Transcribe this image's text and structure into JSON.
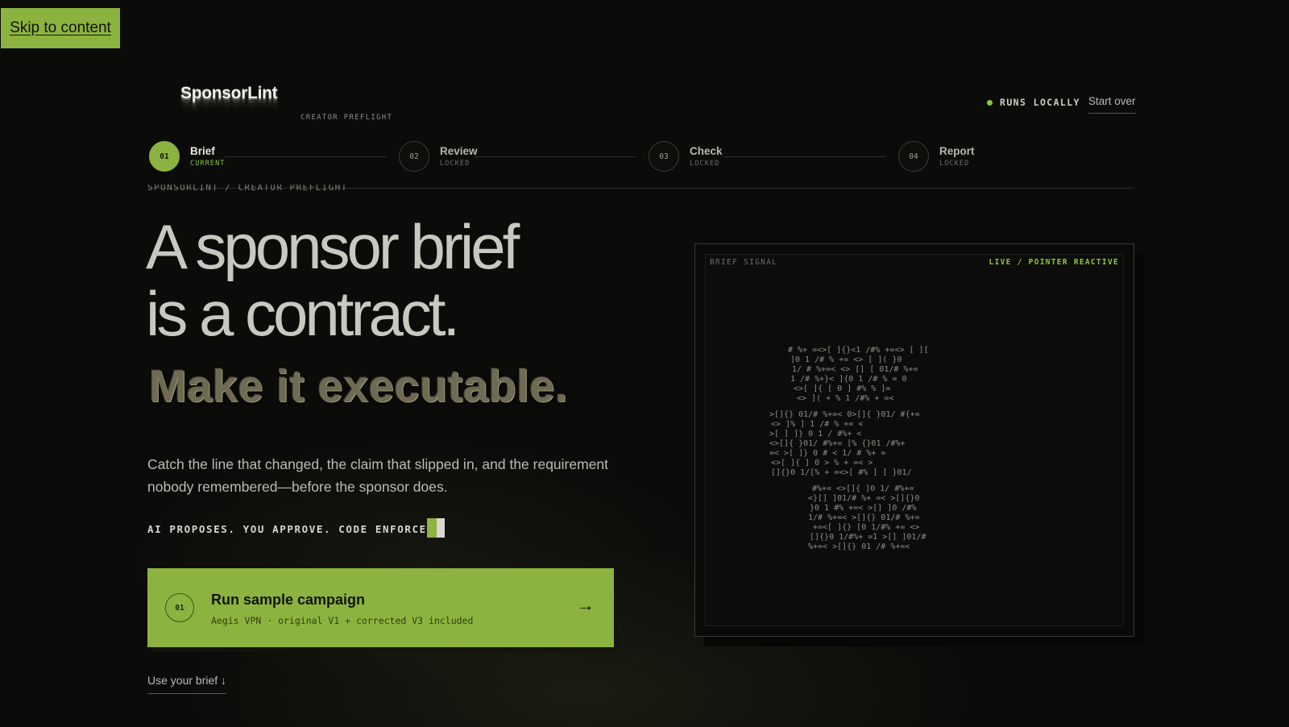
{
  "skip_link": "Skip to content",
  "header": {
    "brand": "SponsorLint",
    "brand_sub": "CREATOR PREFLIGHT",
    "status": "RUNS LOCALLY",
    "start_over": "Start over"
  },
  "steps": [
    {
      "num": "01",
      "title": "Brief",
      "state": "CURRENT"
    },
    {
      "num": "02",
      "title": "Review",
      "state": "LOCKED"
    },
    {
      "num": "03",
      "title": "Check",
      "state": "LOCKED"
    },
    {
      "num": "04",
      "title": "Report",
      "state": "LOCKED"
    }
  ],
  "breadcrumb": "SPONSORLINT / CREATOR PREFLIGHT",
  "hero": {
    "title_line1": "A sponsor brief",
    "title_line2": "is a contract.",
    "accent": "Make it executable.",
    "body": "Catch the line that changed, the claim that slipped in, and the requirement nobody remembered—before the sponsor does.",
    "tagline": "AI PROPOSES. YOU APPROVE. CODE ENFORCE"
  },
  "cta": {
    "num": "01",
    "title": "Run sample campaign",
    "subtitle": "Aegis VPN · original V1 + corrected V3 included",
    "arrow": "→"
  },
  "use_brief": "Use your brief ↓",
  "signal": {
    "label": "BRIEF SIGNAL",
    "live": "LIVE / POINTER REACTIVE"
  },
  "colors": {
    "accent": "#8cb33f",
    "background": "#0b0b09",
    "live_green": "#8cc63f"
  }
}
